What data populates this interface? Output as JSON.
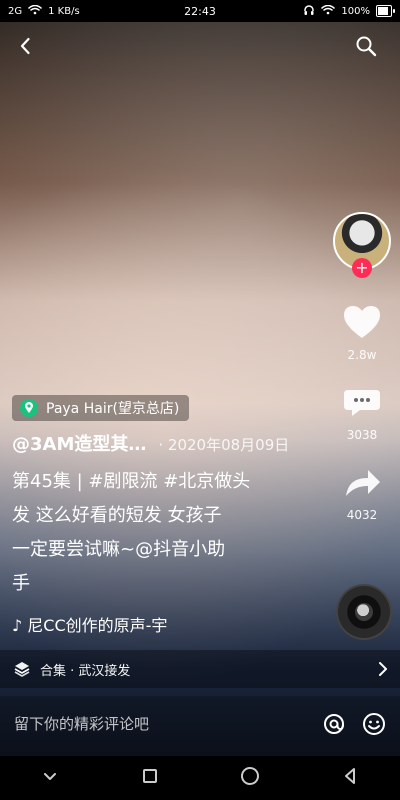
{
  "status_bar": {
    "signal": "2G",
    "network_speed": "1 KB/s",
    "time": "22:43",
    "battery": "100%"
  },
  "icons": {
    "back": "chevron-left-icon",
    "search": "search-icon",
    "like": "heart-icon",
    "comment": "comment-icon",
    "share": "share-icon",
    "location": "map-pin-icon",
    "collection": "layers-icon",
    "chevron_right": "chevron-right-icon",
    "at": "at-icon",
    "emoji": "emoji-icon",
    "music": "music-note-icon",
    "nav_back": "nav-back-icon",
    "nav_home": "nav-home-icon",
    "nav_recent": "nav-recent-icon"
  },
  "right_rail": {
    "follow_plus": "+",
    "likes": "2.8w",
    "comments": "3038",
    "shares": "4032"
  },
  "location_tag": {
    "text": "Paya Hair(望京总店)"
  },
  "post": {
    "author": "@3AM造型其…",
    "date": "· 2020年08月09日",
    "description_lines": [
      "第45集 | #剧限流 #北京做头",
      "发 这么好看的短发 女孩子",
      "一定要尝试嘛~@抖音小助",
      "手"
    ],
    "music_text": "♪ 尼CC创作的原声-宇"
  },
  "collection": {
    "label": "合集 · 武汉接发"
  },
  "comment_bar": {
    "placeholder": "留下你的精彩评论吧"
  },
  "colors": {
    "accent_plus": "#ff2d55",
    "location_pin": "#19c37d"
  }
}
